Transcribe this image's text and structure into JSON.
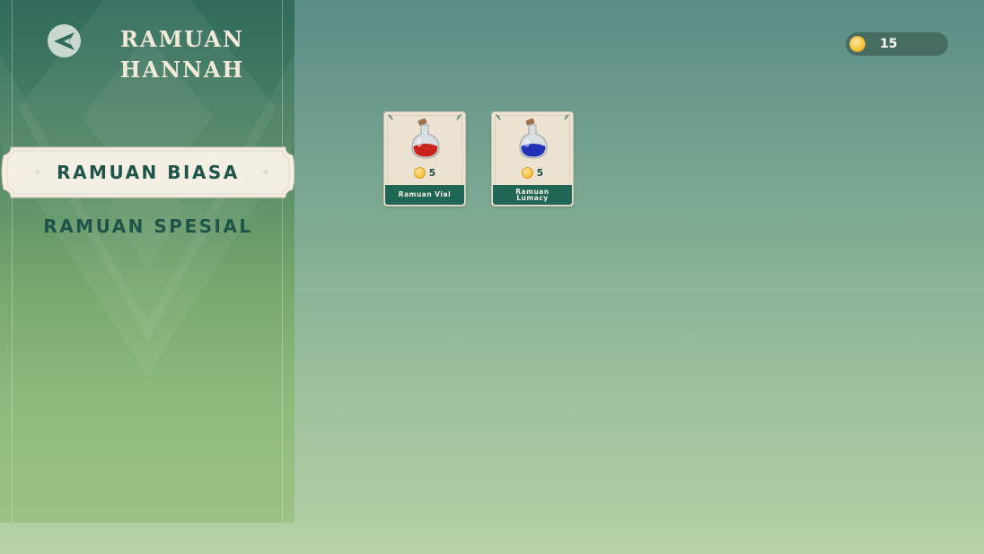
{
  "header": {
    "title": "RAMUAN HANNAH",
    "back_icon": "back-arrow-icon"
  },
  "tabs": [
    {
      "label": "RAMUAN BIASA",
      "active": true
    },
    {
      "label": "RAMUAN SPESIAL",
      "active": false
    }
  ],
  "currency": {
    "icon": "coin-icon",
    "amount": "15"
  },
  "items": [
    {
      "name": "Ramuan Vial",
      "price": "5",
      "icon": "red-potion-icon",
      "liquid_color": "#c8241c"
    },
    {
      "name": "Ramuan Lumacy",
      "price": "5",
      "icon": "blue-potion-icon",
      "liquid_color": "#2232b8"
    }
  ],
  "colors": {
    "primary_dark": "#1f5548",
    "card_bg": "#ece2d2",
    "coin": "#f5c542"
  }
}
